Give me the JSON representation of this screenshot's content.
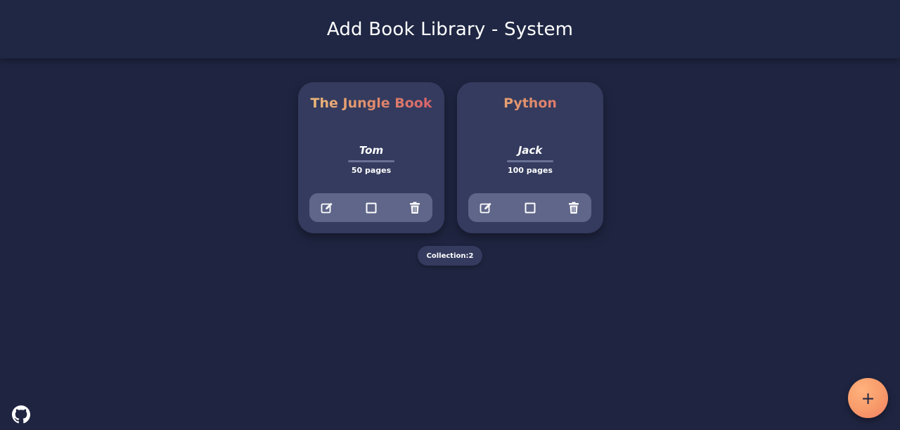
{
  "header": {
    "title": "Add Book Library - System"
  },
  "books": [
    {
      "title": "The Jungle Book",
      "author": "Tom",
      "pages": "50 pages",
      "actions": [
        "edit-icon",
        "checkbox-icon",
        "trash-icon"
      ]
    },
    {
      "title": "Python",
      "author": "Jack",
      "pages": "100 pages",
      "actions": [
        "edit-icon",
        "checkbox-icon",
        "trash-icon"
      ]
    }
  ],
  "collection": {
    "label": "Collection:2"
  },
  "fab": {
    "label": "+"
  },
  "links": {
    "github_icon": "github-icon"
  },
  "colors": {
    "background": "#1f2541",
    "card": "#343b5e",
    "action_bar": "#5f6689",
    "title_gradient_start": "#f1c27d",
    "title_gradient_end": "#d55a6b",
    "fab": "#f89a6a"
  }
}
